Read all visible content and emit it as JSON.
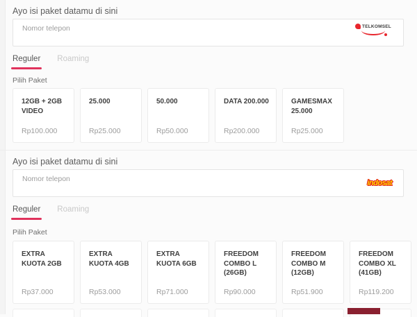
{
  "colors": {
    "accent_tab_underline": "#e0325c",
    "telkomsel_red": "#e8262d",
    "indosat_yellow": "#ffd100",
    "indosat_red": "#e32726",
    "partial_element_red": "#8a2030",
    "page_bg": "#fbfbfb"
  },
  "sections": [
    {
      "title": "Ayo isi paket datamu di sini",
      "input": {
        "placeholder": "Nomor telepon",
        "value": ""
      },
      "operator": {
        "name": "Telkomsel",
        "logo_text": "TELKOMSEL"
      },
      "tabs": [
        {
          "label": "Reguler",
          "active": true
        },
        {
          "label": "Roaming",
          "active": false
        }
      ],
      "packages_label": "Pilih Paket",
      "packages": [
        {
          "name": "12GB + 2GB VIDEO",
          "price": "Rp100.000"
        },
        {
          "name": "25.000",
          "price": "Rp25.000"
        },
        {
          "name": "50.000",
          "price": "Rp50.000"
        },
        {
          "name": "DATA 200.000",
          "price": "Rp200.000"
        },
        {
          "name": "GAMESMAX 25.000",
          "price": "Rp25.000"
        }
      ]
    },
    {
      "title": "Ayo isi paket datamu di sini",
      "input": {
        "placeholder": "Nomor telepon",
        "value": ""
      },
      "operator": {
        "name": "Indosat",
        "logo_text": "indosat"
      },
      "tabs": [
        {
          "label": "Reguler",
          "active": true
        },
        {
          "label": "Roaming",
          "active": false
        }
      ],
      "packages_label": "Pilih Paket",
      "packages": [
        {
          "name": "EXTRA KUOTA 2GB",
          "price": "Rp37.000"
        },
        {
          "name": "EXTRA KUOTA 4GB",
          "price": "Rp53.000"
        },
        {
          "name": "EXTRA KUOTA 6GB",
          "price": "Rp71.000"
        },
        {
          "name": "FREEDOM COMBO L (26GB)",
          "price": "Rp90.000"
        },
        {
          "name": "FREEDOM COMBO M (12GB)",
          "price": "Rp51.900"
        },
        {
          "name": "FREEDOM COMBO XL (41GB)",
          "price": "Rp119.200"
        }
      ]
    }
  ]
}
